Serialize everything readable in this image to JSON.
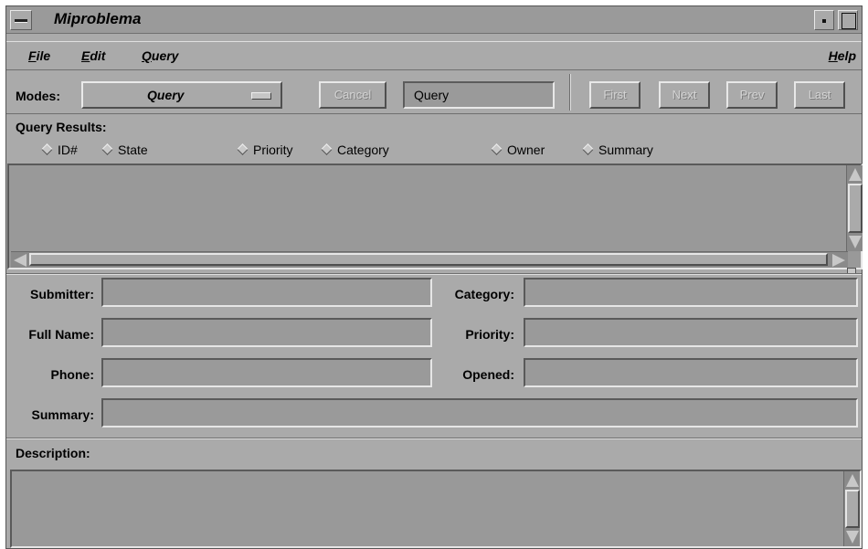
{
  "window": {
    "title": "Miproblema"
  },
  "menubar": {
    "file": "File",
    "edit": "Edit",
    "query": "Query",
    "help": "Help"
  },
  "toolbar": {
    "modes_label": "Modes:",
    "modes_value": "Query",
    "cancel_label": "Cancel",
    "query_field_value": "Query",
    "first_label": "First",
    "next_label": "Next",
    "prev_label": "Prev",
    "last_label": "Last"
  },
  "results": {
    "label": "Query Results:",
    "columns": [
      "ID#",
      "State",
      "Priority",
      "Category",
      "Owner",
      "Summary"
    ]
  },
  "form": {
    "submitter_label": "Submitter:",
    "full_name_label": "Full Name:",
    "phone_label": "Phone:",
    "category_label": "Category:",
    "priority_label": "Priority:",
    "opened_label": "Opened:",
    "summary_label": "Summary:",
    "description_label": "Description:"
  },
  "colors": {
    "window_bg": "#aaaaaa",
    "field_bg": "#9a9a9a",
    "disabled_text": "#d4d4d4"
  }
}
